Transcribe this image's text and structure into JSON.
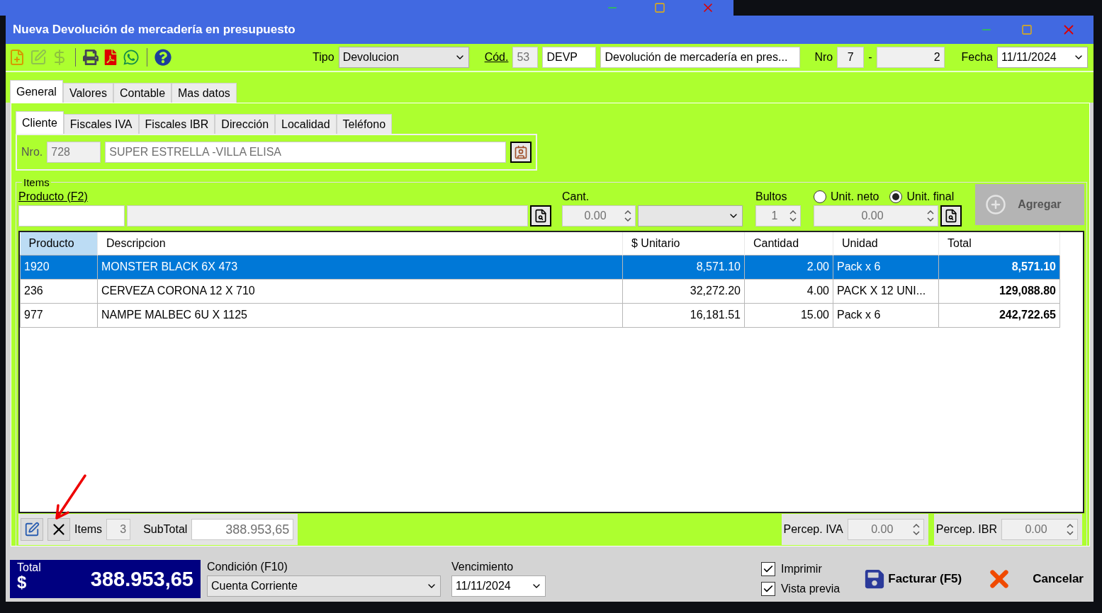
{
  "window": {
    "title": "Nueva Devolución de mercadería en presupuesto"
  },
  "toolbar": {
    "buttons": [
      {
        "kind": "new",
        "disabled": false
      },
      {
        "kind": "edit",
        "disabled": true
      },
      {
        "kind": "refund",
        "disabled": true
      },
      {
        "kind": "print",
        "disabled": false
      },
      {
        "kind": "pdf",
        "disabled": false
      },
      {
        "kind": "whatsapp",
        "disabled": false
      },
      {
        "kind": "help",
        "disabled": false
      }
    ],
    "tipo_label": "Tipo",
    "tipo": "Devolucion",
    "cod_label": "Cód.",
    "cod": "53",
    "code": "DEVP",
    "description": "Devolución de mercadería en pres...",
    "nro_label": "Nro",
    "nro_prefix": "7",
    "nro_separator": "-",
    "nro": "2",
    "fecha_label": "Fecha",
    "fecha": "11/11/2024"
  },
  "tabs": [
    {
      "label": "General",
      "selected": true
    },
    {
      "label": "Valores",
      "selected": false
    },
    {
      "label": "Contable",
      "selected": false
    },
    {
      "label": "Mas datos",
      "selected": false
    }
  ],
  "subtabs": [
    {
      "label": "Cliente",
      "selected": true
    },
    {
      "label": "Fiscales IVA",
      "selected": false
    },
    {
      "label": "Fiscales IBR",
      "selected": false
    },
    {
      "label": "Dirección",
      "selected": false
    },
    {
      "label": "Localidad",
      "selected": false
    },
    {
      "label": "Teléfono",
      "selected": false
    }
  ],
  "cliente": {
    "nro_label": "Nro.",
    "nro": "728",
    "name": "SUPER ESTRELLA -VILLA ELISA"
  },
  "items": {
    "legend": "Items",
    "producto_label": "Producto (F2)",
    "cant_label": "Cant.",
    "cant": "0.00",
    "bultos_label": "Bultos",
    "bultos": "1",
    "radios": [
      {
        "label": "Unit. neto",
        "selected": false
      },
      {
        "label": "Unit. final",
        "selected": true
      }
    ],
    "price": "0.00",
    "add_button": {
      "label": "Agregar",
      "disabled": true
    }
  },
  "table": {
    "columns": [
      {
        "label": "Producto",
        "selected": true
      },
      {
        "label": "Descripcion",
        "selected": false
      },
      {
        "label": "$ Unitario",
        "selected": false
      },
      {
        "label": "Cantidad",
        "selected": false
      },
      {
        "label": "Unidad",
        "selected": false
      },
      {
        "label": "Total",
        "selected": false
      }
    ],
    "rows": [
      {
        "selected": true,
        "cells": [
          "1920",
          "MONSTER BLACK 6X 473",
          "8,571.10",
          "2.00",
          "Pack x 6",
          "8,571.10"
        ]
      },
      {
        "selected": false,
        "cells": [
          "236",
          "CERVEZA CORONA 12 X 710",
          "32,272.20",
          "4.00",
          "PACK X 12 UNI...",
          "129,088.80"
        ]
      },
      {
        "selected": false,
        "cells": [
          "977",
          "NAMPE MALBEC  6U X 1125",
          "16,181.51",
          "15.00",
          "Pack x 6",
          "242,722.65"
        ]
      }
    ]
  },
  "footer": {
    "items_label": "Items",
    "items_count": "3",
    "subtotal_label": "SubTotal",
    "subtotal": "388.953,65",
    "percep_iva_label": "Percep. IVA",
    "percep_iva": "0.00",
    "percep_ibr_label": "Percep. IBR",
    "percep_ibr": "0.00"
  },
  "bottom": {
    "total_label": "Total",
    "currency": "$",
    "total": "388.953,65",
    "condicion_label": "Condición (F10)",
    "condicion": "Cuenta Corriente",
    "vencimiento_label": "Vencimiento",
    "vencimiento": "11/11/2024",
    "checkboxes": [
      {
        "label": "Imprimir",
        "checked": true
      },
      {
        "label": "Vista previa",
        "checked": true
      }
    ],
    "facturar": "Facturar (F5)",
    "cancelar": "Cancelar"
  }
}
